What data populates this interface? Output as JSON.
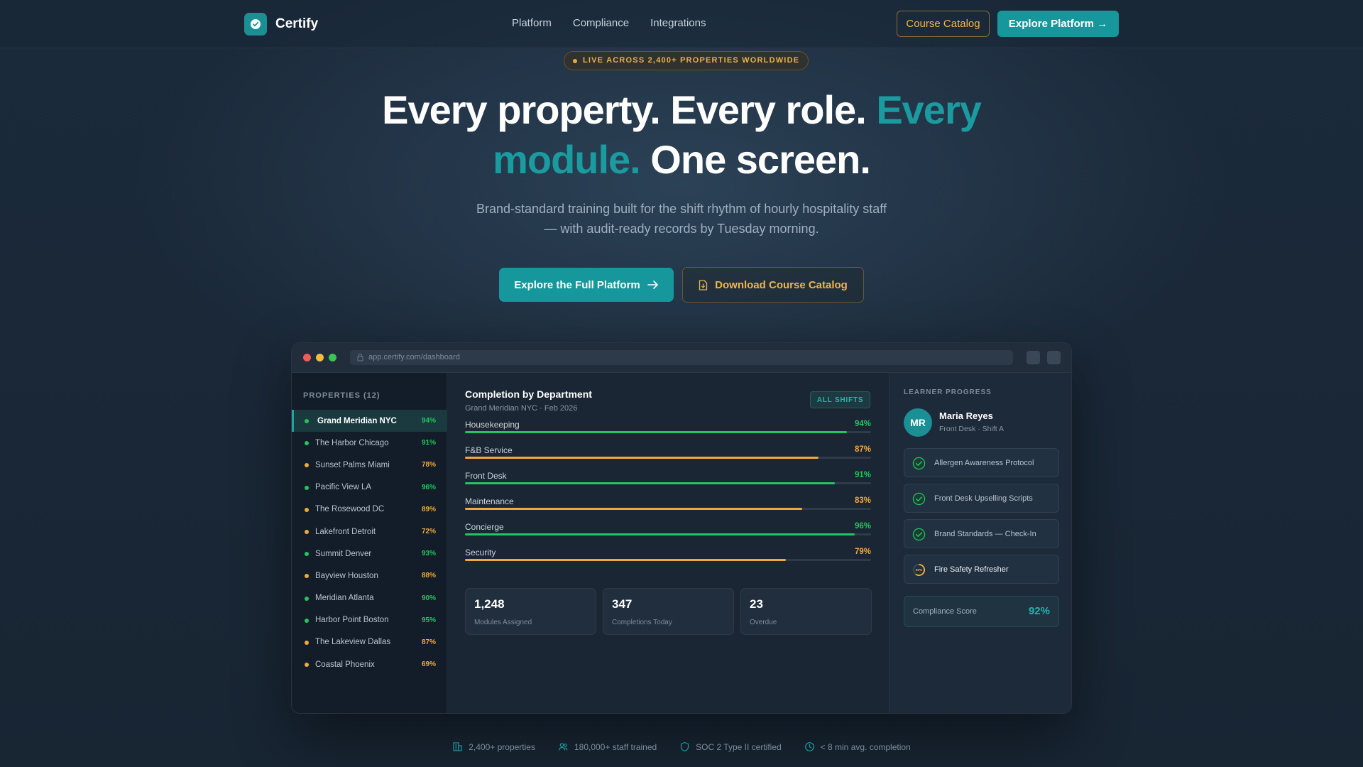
{
  "nav": {
    "brand": "Certify",
    "links": [
      "Platform",
      "Compliance",
      "Integrations"
    ],
    "catalog_btn": "Course Catalog",
    "explore_btn": "Explore Platform →"
  },
  "hero": {
    "badge": "LIVE ACROSS 2,400+ PROPERTIES WORLDWIDE",
    "title_part1": "Every property. Every role. ",
    "title_accent": "Every module.",
    "title_part2": " One screen.",
    "subtitle": "Brand-standard training built for the shift rhythm of hourly hospitality staff — with audit-ready records by Tuesday morning.",
    "primary_btn": "Explore the Full Platform",
    "secondary_btn": "Download Course Catalog"
  },
  "window": {
    "url": "app.certify.com/dashboard"
  },
  "sidebar": {
    "heading": "PROPERTIES (12)",
    "properties": [
      {
        "name": "Grand Meridian NYC",
        "pct": "94%",
        "status": "good",
        "active": true
      },
      {
        "name": "The Harbor Chicago",
        "pct": "91%",
        "status": "good"
      },
      {
        "name": "Sunset Palms Miami",
        "pct": "78%",
        "status": "warn"
      },
      {
        "name": "Pacific View LA",
        "pct": "96%",
        "status": "good"
      },
      {
        "name": "The Rosewood DC",
        "pct": "89%",
        "status": "warn"
      },
      {
        "name": "Lakefront Detroit",
        "pct": "72%",
        "status": "warn"
      },
      {
        "name": "Summit Denver",
        "pct": "93%",
        "status": "good"
      },
      {
        "name": "Bayview Houston",
        "pct": "88%",
        "status": "warn"
      },
      {
        "name": "Meridian Atlanta",
        "pct": "90%",
        "status": "good"
      },
      {
        "name": "Harbor Point Boston",
        "pct": "95%",
        "status": "good"
      },
      {
        "name": "The Lakeview Dallas",
        "pct": "87%",
        "status": "warn"
      },
      {
        "name": "Coastal Phoenix",
        "pct": "69%",
        "status": "warn"
      }
    ]
  },
  "main": {
    "title": "Completion by Department",
    "subtitle": "Grand Meridian NYC · Feb 2026",
    "filter_btn": "ALL SHIFTS",
    "departments": [
      {
        "name": "Housekeeping",
        "pct": "94%",
        "value": 94,
        "status": "good"
      },
      {
        "name": "F&B Service",
        "pct": "87%",
        "value": 87,
        "status": "warn"
      },
      {
        "name": "Front Desk",
        "pct": "91%",
        "value": 91,
        "status": "good"
      },
      {
        "name": "Maintenance",
        "pct": "83%",
        "value": 83,
        "status": "warn"
      },
      {
        "name": "Concierge",
        "pct": "96%",
        "value": 96,
        "status": "good"
      },
      {
        "name": "Security",
        "pct": "79%",
        "value": 79,
        "status": "warn"
      }
    ],
    "stats": [
      {
        "value": "1,248",
        "label": "Modules Assigned"
      },
      {
        "value": "347",
        "label": "Completions Today"
      },
      {
        "value": "23",
        "label": "Overdue"
      }
    ]
  },
  "right": {
    "heading": "LEARNER PROGRESS",
    "avatar": "MR",
    "name": "Maria Reyes",
    "role": "Front Desk · Shift A",
    "modules": [
      {
        "label": "Allergen Awareness Protocol",
        "state": "done"
      },
      {
        "label": "Front Desk Upselling Scripts",
        "state": "done"
      },
      {
        "label": "Brand Standards — Check-In",
        "state": "done"
      },
      {
        "label": "Fire Safety Refresher",
        "state": "in-progress",
        "progress": "60%",
        "progress_value": 0.6
      }
    ],
    "score_label": "Compliance Score",
    "score_value": "92%"
  },
  "footer": [
    {
      "icon": "building-icon",
      "text": "2,400+ properties"
    },
    {
      "icon": "users-icon",
      "text": "180,000+ staff trained"
    },
    {
      "icon": "shield-icon",
      "text": "SOC 2 Type II certified"
    },
    {
      "icon": "clock-icon",
      "text": "< 8 min avg. completion"
    }
  ],
  "colors": {
    "teal": "#16979b",
    "accent_text": "#1a9ba0",
    "amber": "#f0b54a",
    "good": "#22c55e",
    "warn": "#f0a93a"
  }
}
